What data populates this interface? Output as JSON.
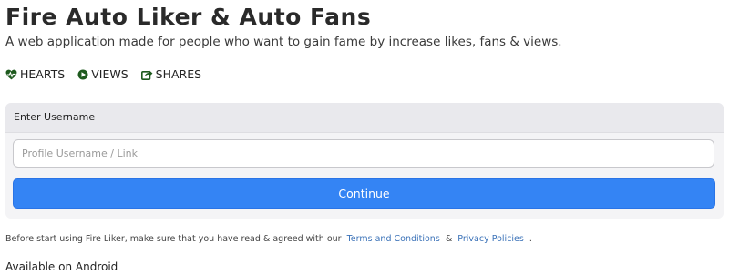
{
  "header": {
    "title": "Fire Auto Liker & Auto Fans",
    "subtitle": "A web application made for people who want to gain fame by increase likes, fans & views."
  },
  "stats": [
    {
      "icon": "heartbeat-icon",
      "label": "HEARTS"
    },
    {
      "icon": "play-circle-icon",
      "label": "VIEWS"
    },
    {
      "icon": "share-icon",
      "label": "SHARES"
    }
  ],
  "form": {
    "header_label": "Enter Username",
    "username_placeholder": "Profile Username / Link",
    "username_value": "",
    "submit_label": "Continue"
  },
  "footer": {
    "note_prefix": "Before start using Fire Liker, make sure that you have read & agreed with our",
    "terms_link": "Terms and Conditions",
    "ampersand": "&",
    "privacy_link": "Privacy Policies",
    "note_suffix": ".",
    "android_label": "Available on Android"
  },
  "colors": {
    "accent": "#3484f4",
    "link": "#3b72b8",
    "icon": "#1e5a1e"
  }
}
